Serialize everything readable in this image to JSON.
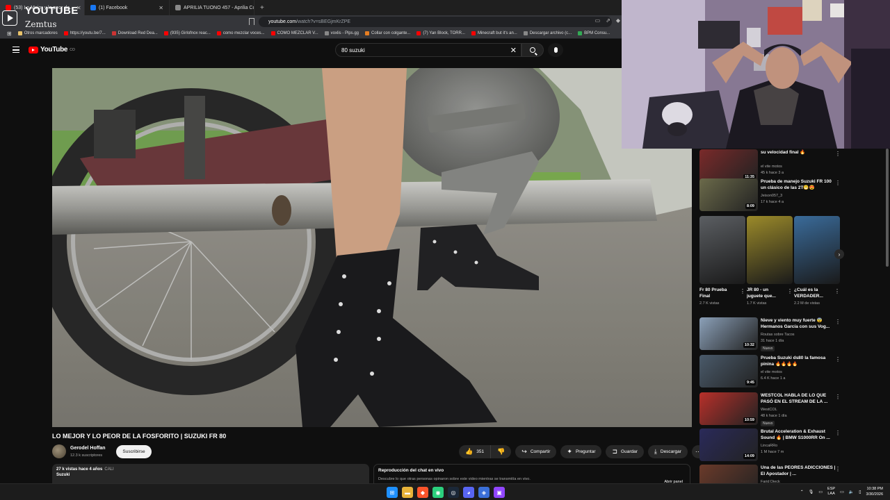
{
  "browser": {
    "tabs": [
      {
        "label": "(53) Lo Mejor y lo peor de...",
        "color": "#ff0000",
        "active": true
      },
      {
        "label": "(1) Facebook",
        "color": "#1877f2",
        "active": false
      },
      {
        "label": "APRILIA TUONO 457 - Aprilia Colom...",
        "color": "#888888",
        "active": false
      }
    ],
    "new_tab": "+",
    "url_host": "youtube.com",
    "url_path": "/watch?v=sBEGjmKrZPE",
    "bookmarks": [
      {
        "label": "Otros marcadores",
        "color": "#e8c26a"
      },
      {
        "label": "https://youtu.be/7...",
        "color": "#ff0000"
      },
      {
        "label": "Download Red Dea...",
        "color": "#c33"
      },
      {
        "label": "(935) Girlofnox reac...",
        "color": "#ff0000"
      },
      {
        "label": "como mezclar voces...",
        "color": "#ff0000"
      },
      {
        "label": "COMO MEZCLAR V...",
        "color": "#ff0000"
      },
      {
        "label": "voxlis - Plps.gg",
        "color": "#888"
      },
      {
        "label": "Collar con colgante...",
        "color": "#e67e22"
      },
      {
        "label": "(7) Yan Block, TORR...",
        "color": "#ff0000"
      },
      {
        "label": "Minecraft but it's an...",
        "color": "#ff0000"
      },
      {
        "label": "Descargar archivo (c...",
        "color": "#888"
      },
      {
        "label": "BPM Consu...",
        "color": "#3a5"
      }
    ]
  },
  "overlay": {
    "title": "YOUTUBE",
    "subtitle": "Zemtus"
  },
  "youtube": {
    "logo_text": "YouTube",
    "logo_country": "CO",
    "search_value": "80 suzuki",
    "video": {
      "title": "LO MEJOR Y LO PEOR DE LA FOSFORITO | SUZUKI FR 80",
      "channel": "Gerodel Hoffan",
      "subscribers": "12.3 k suscriptores",
      "subscribe_label": "Suscribirse",
      "likes": "351",
      "share_label": "Compartir",
      "ask_label": "Preguntar",
      "save_label": "Guardar",
      "download_label": "Descargar",
      "desc_meta": "27 k vistas  hace 4 años",
      "desc_location": "CALI",
      "desc_line2": "Suzuki"
    },
    "chat": {
      "title": "Reproducción del chat en vivo",
      "desc": "Descubre lo que otras personas opinaron sobre este video mientras se transmitía en vivo.",
      "button": "Abrir panel"
    },
    "recs_top": [
      {
        "title": "su velocidad final 🔥",
        "channel": "el vite motos",
        "stats": "45 k  hace 3 a",
        "duration": "11:35",
        "thumb": "#7a2a2a"
      },
      {
        "title": "Prueba de manejo Suzuki FR 100 un clásico de las 2T😁😍",
        "channel": "Jeison057_3",
        "stats": "17 k  hace 4 a",
        "duration": "8:09",
        "thumb": "#6b6a4a"
      }
    ],
    "shorts": [
      {
        "title": "Fr 80 Prueba Final",
        "views": "2.7 K vistas",
        "thumb": "#5b5e62"
      },
      {
        "title": "JR 80 - un juguete que...",
        "views": "1.7 K vistas",
        "thumb": "#9b8a2a"
      },
      {
        "title": "¿Cuál es la VERDADER...",
        "views": "2.2 M de vistas",
        "thumb": "#3a6b9a"
      }
    ],
    "recs_bottom": [
      {
        "title": "Nieve y viento muy fuerte 😨 Hermanos García con sus Vog...",
        "channel": "Routas sobre Tacos",
        "stats": "31  hace 1 día",
        "duration": "10:32",
        "badge": "Nuevo",
        "thumb": "#8ba0b8"
      },
      {
        "title": "Prueba Suzuki ds80 la famosa pinina 🔥🔥🔥🔥",
        "channel": "el vite motos",
        "stats": "6.4 K  hace 1 a",
        "duration": "9:45",
        "badge": "",
        "thumb": "#4a5a6a"
      },
      {
        "title": "WESTCOL HABLA DE LO QUE PASÓ EN EL STREAM DE LA ...",
        "channel": "WestCOL",
        "stats": "48 k  hace 1 día",
        "duration": "10:59",
        "badge": "Nuevo",
        "thumb": "#b8302a"
      },
      {
        "title": "Brutal Acceleration & Exhaust Sound 🔥 | BMW S1000RR On ...",
        "channel": "LincaRRo",
        "stats": "1 M  hace 7 m",
        "duration": "14:09",
        "badge": "",
        "thumb": "#2a2a5a"
      },
      {
        "title": "Una de las PEORES ADICCIONES | El Apostador | ...",
        "channel": "Farid Dieck",
        "stats": "",
        "duration": "",
        "badge": "",
        "thumb": "#6a3a2a"
      }
    ]
  },
  "taskbar": {
    "apps": [
      {
        "icon": "windows-icon",
        "color": "#1e90ff"
      },
      {
        "icon": "folder-icon",
        "color": "#e8b339"
      },
      {
        "icon": "brave-icon",
        "color": "#fb542b"
      },
      {
        "icon": "obs-icon",
        "color": "#2bd07d"
      },
      {
        "icon": "steam-icon",
        "color": "#1b2838"
      },
      {
        "icon": "discord-icon",
        "color": "#5865f2"
      },
      {
        "icon": "app-icon",
        "color": "#3a6fd8"
      },
      {
        "icon": "twitch-icon",
        "color": "#9146ff"
      }
    ],
    "lang_top": "ESP",
    "lang_bottom": "LAA",
    "time": "10:38 PM",
    "date": "3/30/2026"
  }
}
